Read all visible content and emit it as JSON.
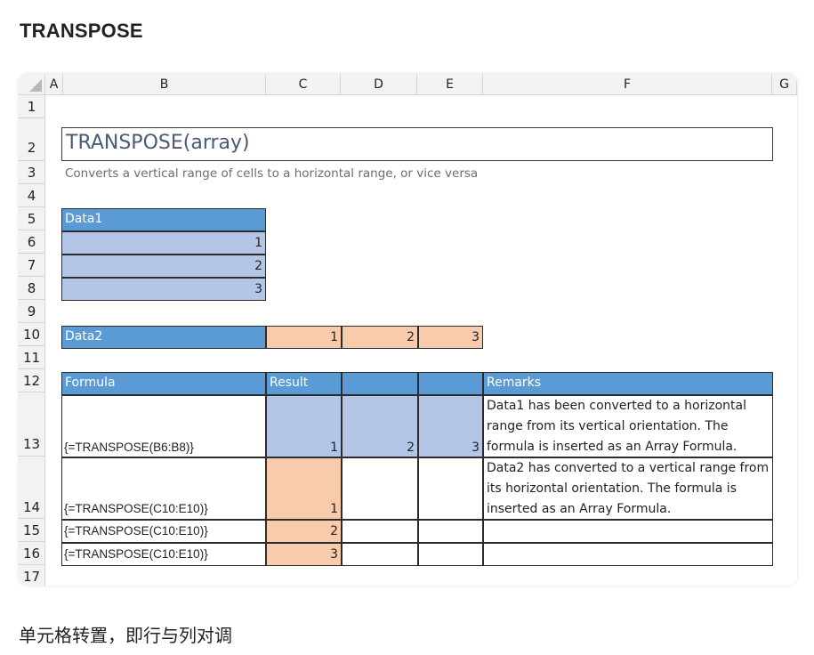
{
  "heading": "TRANSPOSE",
  "columns": [
    "A",
    "B",
    "C",
    "D",
    "E",
    "F",
    "G"
  ],
  "rows": [
    "1",
    "2",
    "3",
    "4",
    "5",
    "6",
    "7",
    "8",
    "9",
    "10",
    "11",
    "12",
    "13",
    "14",
    "15",
    "16",
    "17"
  ],
  "sheet": {
    "title": "TRANSPOSE(array)",
    "subtitle": "Converts a vertical range of cells to a horizontal range, or vice versa",
    "data1": {
      "label": "Data1",
      "values": [
        "1",
        "2",
        "3"
      ]
    },
    "data2": {
      "label": "Data2",
      "values": [
        "1",
        "2",
        "3"
      ]
    },
    "table": {
      "headers": {
        "formula": "Formula",
        "result": "Result",
        "d": "",
        "e": "",
        "remarks": "Remarks"
      },
      "rows": [
        {
          "formula": "{=TRANSPOSE(B6:B8)}",
          "c": "1",
          "d": "2",
          "e": "3",
          "remarks": "Data1 has been converted to a horizontal range from its vertical orientation. The formula is inserted as an Array Formula."
        },
        {
          "formula": "{=TRANSPOSE(C10:E10)}",
          "c": "1",
          "d": "",
          "e": "",
          "remarks": "Data2 has converted to a vertical range from its horizontal orientation. The formula is inserted as an Array Formula."
        },
        {
          "formula": "{=TRANSPOSE(C10:E10)}",
          "c": "2",
          "d": "",
          "e": "",
          "remarks": ""
        },
        {
          "formula": "{=TRANSPOSE(C10:E10)}",
          "c": "3",
          "d": "",
          "e": "",
          "remarks": ""
        }
      ]
    }
  },
  "colors": {
    "header_blue": "#5b9bd5",
    "lavender": "#b4c6e7",
    "peach": "#f8cbad"
  },
  "footer_text": "单元格转置，即行与列对调"
}
